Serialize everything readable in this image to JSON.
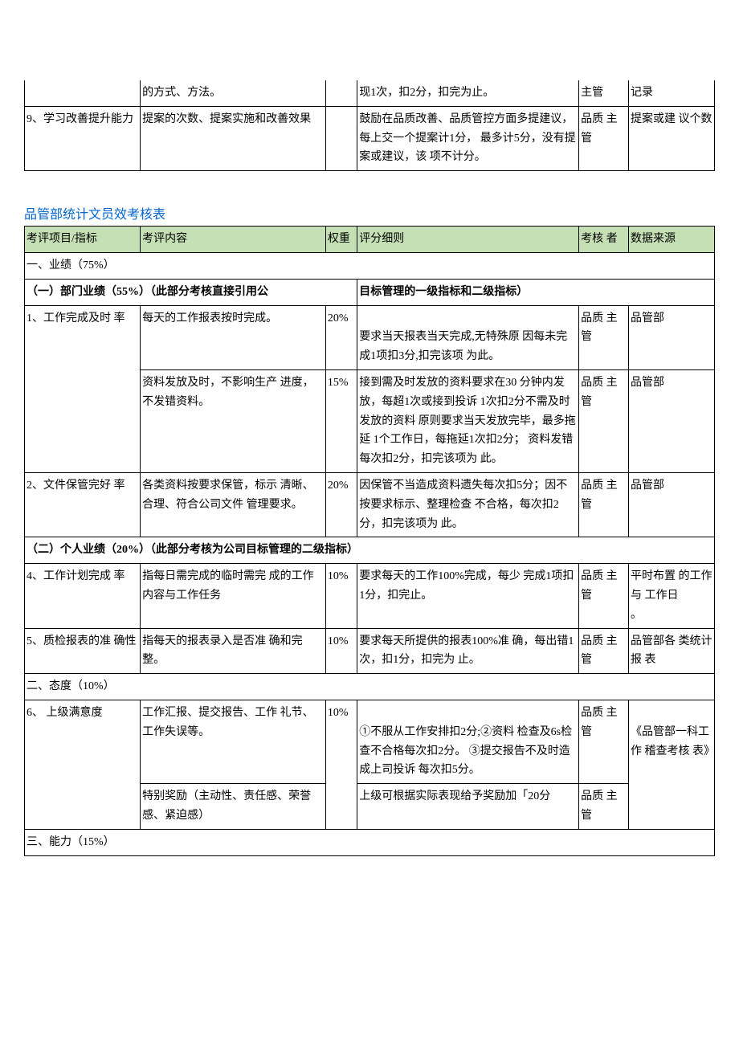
{
  "top_table": {
    "rows": [
      {
        "c1": "",
        "c2": "的方式、方法。",
        "c3": "",
        "c4": "现1次，扣2分，扣完为止。",
        "c5": "主管",
        "c6": "记录"
      },
      {
        "c1": "9、学习改善提升能力",
        "c2": "提案的次数、提案实施和改善效果",
        "c3": "",
        "c4": "鼓励在品质改善、品质管控方面多提建议，每上交一个提案计1分，  最多计5分，没有提案或建议，该  项不计分。",
        "c5": "品质  主管",
        "c6": "提案或建  议个数"
      }
    ]
  },
  "title2": "品管部统计文员效考核表",
  "headers": {
    "c1": "考评项目/指标",
    "c2": "考评内容",
    "c3": "权重",
    "c4": "评分细则",
    "c5": "考核  者",
    "c6": "数据来源"
  },
  "sec1": "一、业绩（75%）",
  "sec1a_left": "（一）部门业绩（55%）（此部分考核直接引用公",
  "sec1a_right": "目标管理的一级指标和二级指标）",
  "r1": {
    "c1": "1、工作完成及时  率",
    "c2": "每天的工作报表按时完成。",
    "c3": "20%",
    "c4": "要求当天报表当天完成,无特殊原  因每未完成1项扣3分,扣完该项  为此。",
    "c5": "品质  主管",
    "c6": "品管部"
  },
  "r1b": {
    "c2": "资料发放及时，不影响生产  进度，不发错资料。",
    "c3": "15%",
    "c4": "接到需及时发放的资料要求在30  分钟内发放，每超1次或接到投诉  1次扣2分不需及时发放的资料    原则要求当天发放完毕，最多拖延   1个工作日，每拖延1次扣2分；  资料发错每次扣2分，扣完该项为  此。",
    "c5": "品质  主管",
    "c6": "品管部"
  },
  "r2": {
    "c1": "2、文件保管完好  率",
    "c2": "各类资料按要求保管，标示  清晰、合理、符合公司文件  管理要求。",
    "c3": "20%",
    "c4": "因保管不当造成资料遗失每次扣5分；因不按要求标示、整理检查  不合格，每次扣2分，扣完该项为  此。",
    "c5": "品质  主管",
    "c6": "品管部"
  },
  "sec1b": "（二）个人业绩（20%）（此部分考核为公司目标管理的二级指标）",
  "r4": {
    "c1": "4、工作计划完成  率",
    "c2": "指每日需完成的临时需完    成的工作内容与工作任务",
    "c3": "10%",
    "c4": "要求每天的工作100%完成，每少  完成1项扣1分，扣完止。",
    "c5": "品质  主管",
    "c6": "平时布置  的工作与  工作日\n。"
  },
  "r5": {
    "c1": "5、质检报表的准  确性",
    "c2": "指每天的报表录入是否准    确和完整。",
    "c3": "10%",
    "c4": "要求每天所提供的报表100%准  确，每出错1次，扣1分，扣完为  止。",
    "c5": "品质  主管",
    "c6": "品管部各  类统计报  表"
  },
  "sec2": "二、态度（10%）",
  "r6": {
    "c1": "6、 上级满意度",
    "c2": "工作汇报、提交报告、工作  礼节、工作失误等。",
    "c3": "10%",
    "c4": "①不服从工作安排扣2分;②资料  检查及6s检查不合格每次扣2分。    ③提交报告不及时造成上司投诉  每次扣5分。",
    "c5": "品质  主管",
    "c6": "《品管部一科工作  稽查考核  表》"
  },
  "r6b": {
    "c2": "特别奖励（主动性、责任感、荣誉感、紧迫感）",
    "c4": " 上级可根据实际表现给予奖励加「20分",
    "c5": "品质  主管"
  },
  "sec3": "三、能力（15%）"
}
